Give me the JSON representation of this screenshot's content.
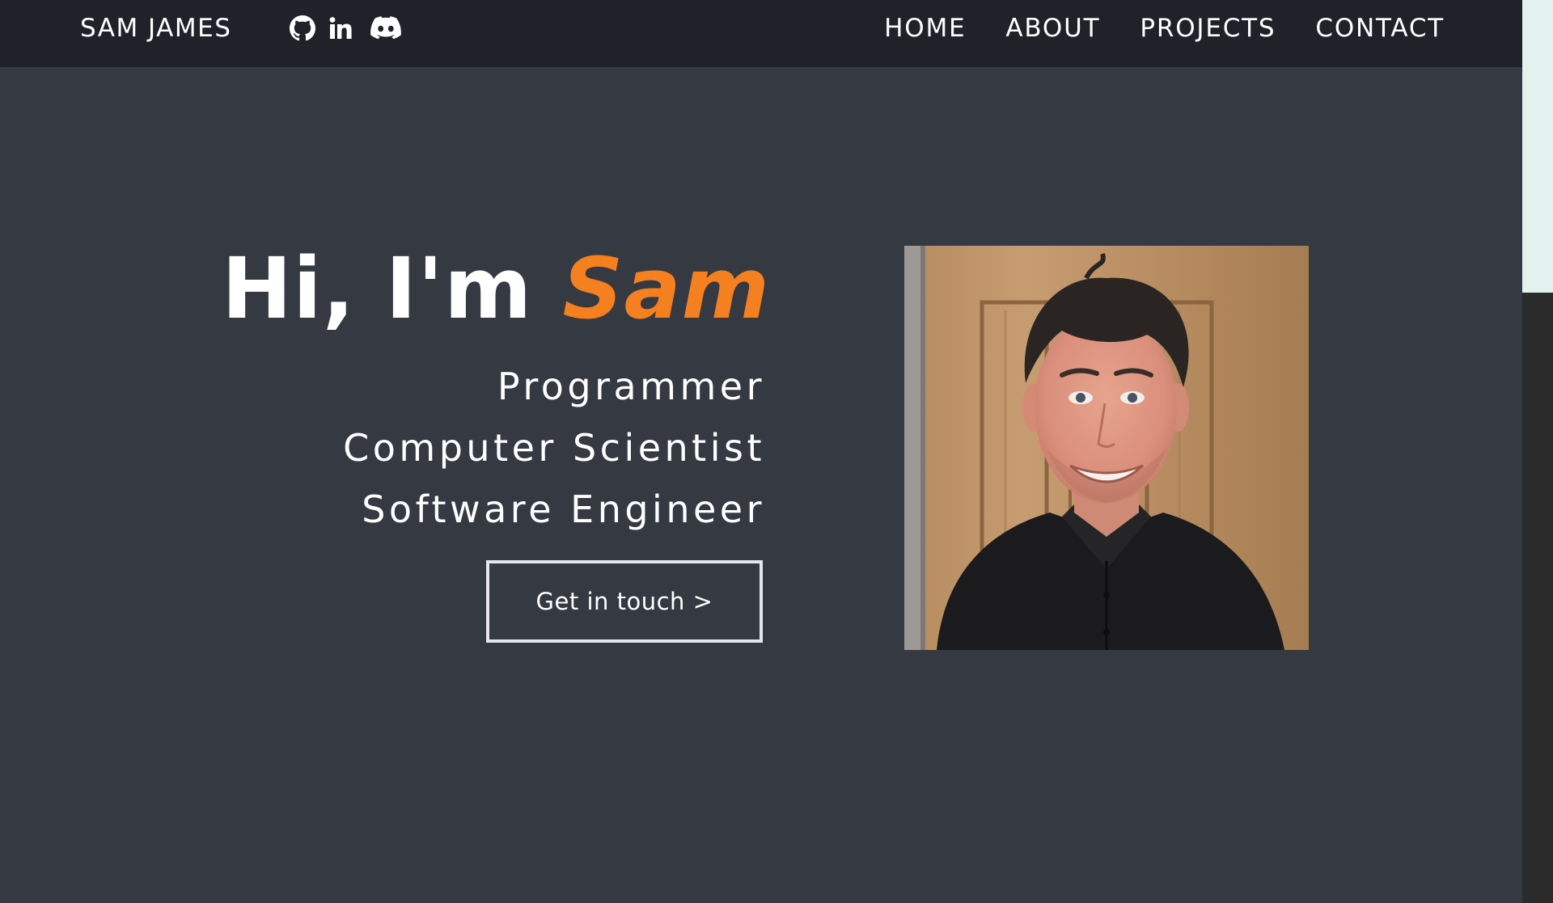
{
  "navbar": {
    "brand": "SAM JAMES",
    "social": [
      {
        "icon": "github-icon",
        "label": "GitHub"
      },
      {
        "icon": "linkedin-icon",
        "label": "LinkedIn"
      },
      {
        "icon": "discord-icon",
        "label": "Discord"
      }
    ],
    "links": [
      "HOME",
      "ABOUT",
      "PROJECTS",
      "CONTACT"
    ]
  },
  "hero": {
    "greeting": "Hi, I'm ",
    "name": "Sam",
    "roles": [
      "Programmer",
      "Computer Scientist",
      "Software Engineer"
    ],
    "cta_label": "Get in touch >"
  },
  "colors": {
    "background": "#353942",
    "navbar": "#1f2229",
    "accent": "#f4801f",
    "text": "#ffffff",
    "scroll_thumb": "#e3f2ef"
  }
}
